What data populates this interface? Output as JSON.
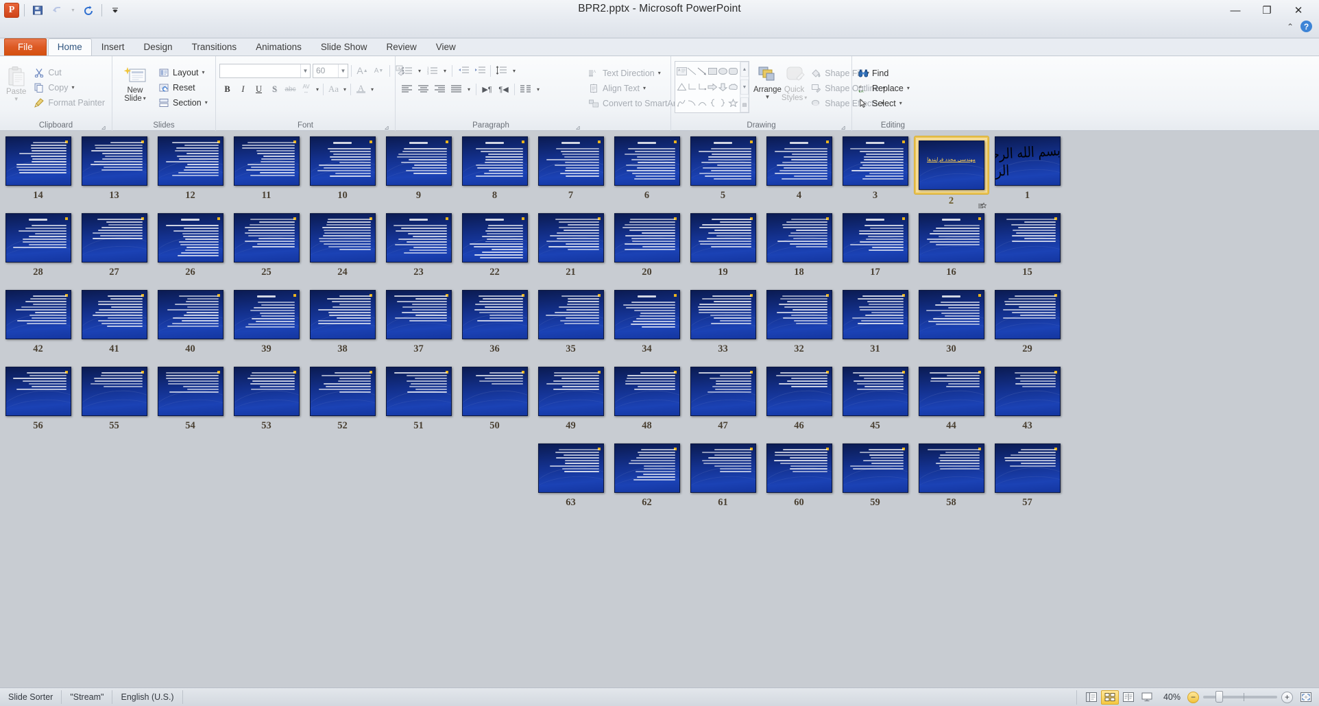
{
  "window": {
    "title": "BPR2.pptx  -  Microsoft PowerPoint",
    "minimize": "—",
    "restore": "❐",
    "close": "✕",
    "minimize_ribbon": "⌃",
    "help": "?"
  },
  "quick_access": {
    "app_icon": "powerpoint-logo",
    "items": [
      {
        "name": "save-icon",
        "glyph": "💾",
        "label": "Save"
      },
      {
        "name": "undo-icon",
        "glyph": "↺",
        "label": "Undo"
      },
      {
        "name": "undo-dropdown-icon",
        "glyph": "▾",
        "label": "Undo options"
      },
      {
        "name": "redo-icon",
        "glyph": "↻",
        "label": "Repeat"
      },
      {
        "name": "customize-qat-icon",
        "glyph": "▾",
        "label": "Customize Quick Access Toolbar"
      }
    ]
  },
  "tabs": [
    {
      "label": "File",
      "kind": "file"
    },
    {
      "label": "Home",
      "kind": "active"
    },
    {
      "label": "Insert",
      "kind": "normal"
    },
    {
      "label": "Design",
      "kind": "normal"
    },
    {
      "label": "Transitions",
      "kind": "normal"
    },
    {
      "label": "Animations",
      "kind": "normal"
    },
    {
      "label": "Slide Show",
      "kind": "normal"
    },
    {
      "label": "Review",
      "kind": "normal"
    },
    {
      "label": "View",
      "kind": "normal"
    }
  ],
  "ribbon": {
    "clipboard": {
      "label": "Clipboard",
      "paste": "Paste",
      "cut": "Cut",
      "copy": "Copy",
      "format_painter": "Format Painter"
    },
    "slides": {
      "label": "Slides",
      "new_slide_line1": "New",
      "new_slide_line2": "Slide",
      "layout": "Layout",
      "reset": "Reset",
      "section": "Section"
    },
    "font": {
      "label": "Font",
      "font_name_value": "",
      "font_size_value": "60",
      "bold": "B",
      "italic": "I",
      "underline": "U",
      "shadow": "S",
      "strikethrough": "abc",
      "character_spacing": "AV",
      "change_case": "Aa",
      "font_color": "A",
      "grow_font": "A",
      "shrink_font": "A",
      "clear_formatting": "Aa"
    },
    "paragraph": {
      "label": "Paragraph",
      "text_direction": "Text Direction",
      "align_text": "Align Text",
      "convert_to_smartart": "Convert to SmartArt"
    },
    "drawing": {
      "label": "Drawing",
      "arrange": "Arrange",
      "quick_styles_line1": "Quick",
      "quick_styles_line2": "Styles",
      "shape_fill": "Shape Fill",
      "shape_outline": "Shape Outline",
      "shape_effects": "Shape Effects"
    },
    "editing": {
      "label": "Editing",
      "find": "Find",
      "replace": "Replace",
      "select": "Select"
    }
  },
  "slide_sorter": {
    "selected_slide": 2,
    "rows": [
      {
        "slides": [
          {
            "num": "14",
            "type": "text",
            "lines": 12
          },
          {
            "num": "13",
            "type": "text",
            "lines": 11
          },
          {
            "num": "12",
            "type": "text",
            "lines": 13
          },
          {
            "num": "11",
            "type": "text",
            "lines": 13
          },
          {
            "num": "10",
            "type": "titled",
            "title": "",
            "lines": 11
          },
          {
            "num": "9",
            "type": "titled",
            "title": "",
            "lines": 10
          },
          {
            "num": "8",
            "type": "titled",
            "title": "",
            "lines": 11
          },
          {
            "num": "7",
            "type": "titled",
            "title": "",
            "lines": 11
          },
          {
            "num": "6",
            "type": "titled",
            "title": "",
            "lines": 12
          },
          {
            "num": "5",
            "type": "titled",
            "title": "",
            "lines": 12
          },
          {
            "num": "4",
            "type": "titled",
            "title": "",
            "lines": 12
          },
          {
            "num": "3",
            "type": "titled",
            "title": "",
            "lines": 12
          },
          {
            "num": "2",
            "type": "title-only",
            "title": "مهندسی مجدد فرایندها",
            "lines": 0,
            "selected": true
          },
          {
            "num": "1",
            "type": "calligraphy",
            "title": "",
            "lines": 0
          }
        ]
      },
      {
        "slides": [
          {
            "num": "28",
            "type": "titled",
            "lines": 9
          },
          {
            "num": "27",
            "type": "text",
            "lines": 8
          },
          {
            "num": "26",
            "type": "titled",
            "lines": 12
          },
          {
            "num": "25",
            "type": "text",
            "lines": 11
          },
          {
            "num": "24",
            "type": "text",
            "lines": 12
          },
          {
            "num": "23",
            "type": "titled",
            "lines": 11
          },
          {
            "num": "22",
            "type": "titled",
            "lines": 13
          },
          {
            "num": "21",
            "type": "text",
            "lines": 12
          },
          {
            "num": "20",
            "type": "text",
            "lines": 12
          },
          {
            "num": "19",
            "type": "text",
            "lines": 11
          },
          {
            "num": "18",
            "type": "text",
            "lines": 11
          },
          {
            "num": "17",
            "type": "titled",
            "lines": 10
          },
          {
            "num": "16",
            "type": "titled",
            "lines": 8
          },
          {
            "num": "15",
            "type": "text",
            "lines": 9
          }
        ]
      },
      {
        "slides": [
          {
            "num": "42",
            "type": "text",
            "lines": 11
          },
          {
            "num": "41",
            "type": "text",
            "lines": 12
          },
          {
            "num": "40",
            "type": "text",
            "lines": 12
          },
          {
            "num": "39",
            "type": "titled",
            "lines": 10
          },
          {
            "num": "38",
            "type": "text",
            "lines": 11
          },
          {
            "num": "37",
            "type": "text",
            "lines": 10
          },
          {
            "num": "36",
            "type": "text",
            "lines": 10
          },
          {
            "num": "35",
            "type": "text",
            "lines": 11
          },
          {
            "num": "34",
            "type": "titled",
            "lines": 10
          },
          {
            "num": "33",
            "type": "text",
            "lines": 11
          },
          {
            "num": "32",
            "type": "text",
            "lines": 11
          },
          {
            "num": "31",
            "type": "text",
            "lines": 11
          },
          {
            "num": "30",
            "type": "titled",
            "lines": 9
          },
          {
            "num": "29",
            "type": "text",
            "lines": 9
          }
        ]
      },
      {
        "slides": [
          {
            "num": "56",
            "type": "text",
            "lines": 7
          },
          {
            "num": "55",
            "type": "text",
            "lines": 6
          },
          {
            "num": "54",
            "type": "text",
            "lines": 8
          },
          {
            "num": "53",
            "type": "text",
            "lines": 7
          },
          {
            "num": "52",
            "type": "text",
            "lines": 8
          },
          {
            "num": "51",
            "type": "text",
            "lines": 8
          },
          {
            "num": "50",
            "type": "text",
            "lines": 5
          },
          {
            "num": "49",
            "type": "text",
            "lines": 7
          },
          {
            "num": "48",
            "type": "text",
            "lines": 7
          },
          {
            "num": "47",
            "type": "text",
            "lines": 8
          },
          {
            "num": "46",
            "type": "text",
            "lines": 6
          },
          {
            "num": "45",
            "type": "text",
            "lines": 7
          },
          {
            "num": "44",
            "type": "text",
            "lines": 6
          },
          {
            "num": "43",
            "type": "text",
            "lines": 6
          }
        ]
      },
      {
        "offset": 7,
        "slides": [
          {
            "num": "63",
            "type": "text",
            "lines": 9
          },
          {
            "num": "62",
            "type": "text",
            "lines": 12
          },
          {
            "num": "61",
            "type": "text",
            "lines": 9
          },
          {
            "num": "60",
            "type": "text",
            "lines": 9
          },
          {
            "num": "59",
            "type": "text",
            "lines": 8
          },
          {
            "num": "58",
            "type": "text",
            "lines": 8
          },
          {
            "num": "57",
            "type": "text",
            "lines": 7
          }
        ]
      }
    ]
  },
  "status_bar": {
    "view_name": "Slide Sorter",
    "theme_name": "\"Stream\"",
    "language": "English (U.S.)",
    "zoom_level": "40%",
    "zoom_out": "−",
    "zoom_in": "+",
    "views": [
      {
        "name": "normal-view-button",
        "label": "Normal",
        "active": false
      },
      {
        "name": "slide-sorter-view-button",
        "label": "Slide Sorter",
        "active": true
      },
      {
        "name": "reading-view-button",
        "label": "Reading View",
        "active": false
      },
      {
        "name": "slide-show-button",
        "label": "Slide Show",
        "active": false
      }
    ],
    "fit_to_window": "Fit slide to current window"
  },
  "colors": {
    "accent_orange": "#dd5a24",
    "selection_gold": "#e8c251",
    "slide_blue": "#13308c",
    "status_bg": "#d3d8df"
  }
}
